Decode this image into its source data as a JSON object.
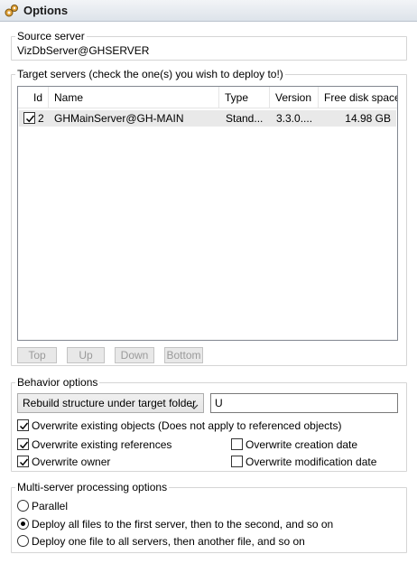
{
  "window": {
    "title": "Options"
  },
  "source": {
    "legend": "Source server",
    "value": "VizDbServer@GHSERVER"
  },
  "targets": {
    "legend": "Target servers (check the one(s) you wish to deploy to!)",
    "columns": [
      "Id",
      "Name",
      "Type",
      "Version",
      "Free disk space"
    ],
    "rows": [
      {
        "checked": true,
        "id": "2",
        "name": "GHMainServer@GH-MAIN",
        "type": "Stand...",
        "version": "3.3.0....",
        "free_disk": "14.98 GB"
      }
    ],
    "buttons": {
      "top": "Top",
      "up": "Up",
      "down": "Down",
      "bottom": "Bottom"
    }
  },
  "behavior": {
    "legend": "Behavior options",
    "mode_selected": "Rebuild structure under target folder",
    "folder_value": "U",
    "options": {
      "overwrite_objects": {
        "label": "Overwrite existing objects (Does not apply to referenced objects)",
        "checked": true
      },
      "overwrite_references": {
        "label": "Overwrite existing references",
        "checked": true
      },
      "overwrite_creation_date": {
        "label": "Overwrite creation date",
        "checked": false
      },
      "overwrite_owner": {
        "label": "Overwrite owner",
        "checked": true
      },
      "overwrite_modification_date": {
        "label": "Overwrite modification date",
        "checked": false
      }
    }
  },
  "multiserver": {
    "legend": "Multi-server processing options",
    "options": [
      {
        "label": "Parallel",
        "selected": false
      },
      {
        "label": "Deploy all files to the first server, then to the second, and so on",
        "selected": true
      },
      {
        "label": "Deploy one file to all servers, then another file, and so on",
        "selected": false
      }
    ]
  }
}
